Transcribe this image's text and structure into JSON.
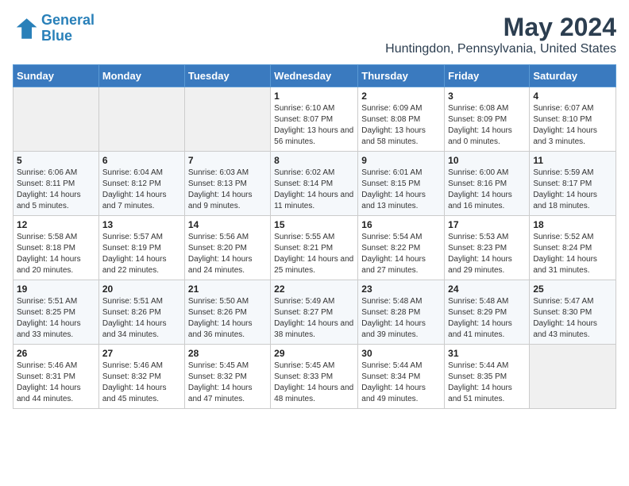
{
  "logo": {
    "line1": "General",
    "line2": "Blue"
  },
  "title": "May 2024",
  "subtitle": "Huntingdon, Pennsylvania, United States",
  "days_of_week": [
    "Sunday",
    "Monday",
    "Tuesday",
    "Wednesday",
    "Thursday",
    "Friday",
    "Saturday"
  ],
  "weeks": [
    [
      {
        "num": "",
        "sunrise": "",
        "sunset": "",
        "daylight": ""
      },
      {
        "num": "",
        "sunrise": "",
        "sunset": "",
        "daylight": ""
      },
      {
        "num": "",
        "sunrise": "",
        "sunset": "",
        "daylight": ""
      },
      {
        "num": "1",
        "sunrise": "Sunrise: 6:10 AM",
        "sunset": "Sunset: 8:07 PM",
        "daylight": "Daylight: 13 hours and 56 minutes."
      },
      {
        "num": "2",
        "sunrise": "Sunrise: 6:09 AM",
        "sunset": "Sunset: 8:08 PM",
        "daylight": "Daylight: 13 hours and 58 minutes."
      },
      {
        "num": "3",
        "sunrise": "Sunrise: 6:08 AM",
        "sunset": "Sunset: 8:09 PM",
        "daylight": "Daylight: 14 hours and 0 minutes."
      },
      {
        "num": "4",
        "sunrise": "Sunrise: 6:07 AM",
        "sunset": "Sunset: 8:10 PM",
        "daylight": "Daylight: 14 hours and 3 minutes."
      }
    ],
    [
      {
        "num": "5",
        "sunrise": "Sunrise: 6:06 AM",
        "sunset": "Sunset: 8:11 PM",
        "daylight": "Daylight: 14 hours and 5 minutes."
      },
      {
        "num": "6",
        "sunrise": "Sunrise: 6:04 AM",
        "sunset": "Sunset: 8:12 PM",
        "daylight": "Daylight: 14 hours and 7 minutes."
      },
      {
        "num": "7",
        "sunrise": "Sunrise: 6:03 AM",
        "sunset": "Sunset: 8:13 PM",
        "daylight": "Daylight: 14 hours and 9 minutes."
      },
      {
        "num": "8",
        "sunrise": "Sunrise: 6:02 AM",
        "sunset": "Sunset: 8:14 PM",
        "daylight": "Daylight: 14 hours and 11 minutes."
      },
      {
        "num": "9",
        "sunrise": "Sunrise: 6:01 AM",
        "sunset": "Sunset: 8:15 PM",
        "daylight": "Daylight: 14 hours and 13 minutes."
      },
      {
        "num": "10",
        "sunrise": "Sunrise: 6:00 AM",
        "sunset": "Sunset: 8:16 PM",
        "daylight": "Daylight: 14 hours and 16 minutes."
      },
      {
        "num": "11",
        "sunrise": "Sunrise: 5:59 AM",
        "sunset": "Sunset: 8:17 PM",
        "daylight": "Daylight: 14 hours and 18 minutes."
      }
    ],
    [
      {
        "num": "12",
        "sunrise": "Sunrise: 5:58 AM",
        "sunset": "Sunset: 8:18 PM",
        "daylight": "Daylight: 14 hours and 20 minutes."
      },
      {
        "num": "13",
        "sunrise": "Sunrise: 5:57 AM",
        "sunset": "Sunset: 8:19 PM",
        "daylight": "Daylight: 14 hours and 22 minutes."
      },
      {
        "num": "14",
        "sunrise": "Sunrise: 5:56 AM",
        "sunset": "Sunset: 8:20 PM",
        "daylight": "Daylight: 14 hours and 24 minutes."
      },
      {
        "num": "15",
        "sunrise": "Sunrise: 5:55 AM",
        "sunset": "Sunset: 8:21 PM",
        "daylight": "Daylight: 14 hours and 25 minutes."
      },
      {
        "num": "16",
        "sunrise": "Sunrise: 5:54 AM",
        "sunset": "Sunset: 8:22 PM",
        "daylight": "Daylight: 14 hours and 27 minutes."
      },
      {
        "num": "17",
        "sunrise": "Sunrise: 5:53 AM",
        "sunset": "Sunset: 8:23 PM",
        "daylight": "Daylight: 14 hours and 29 minutes."
      },
      {
        "num": "18",
        "sunrise": "Sunrise: 5:52 AM",
        "sunset": "Sunset: 8:24 PM",
        "daylight": "Daylight: 14 hours and 31 minutes."
      }
    ],
    [
      {
        "num": "19",
        "sunrise": "Sunrise: 5:51 AM",
        "sunset": "Sunset: 8:25 PM",
        "daylight": "Daylight: 14 hours and 33 minutes."
      },
      {
        "num": "20",
        "sunrise": "Sunrise: 5:51 AM",
        "sunset": "Sunset: 8:26 PM",
        "daylight": "Daylight: 14 hours and 34 minutes."
      },
      {
        "num": "21",
        "sunrise": "Sunrise: 5:50 AM",
        "sunset": "Sunset: 8:26 PM",
        "daylight": "Daylight: 14 hours and 36 minutes."
      },
      {
        "num": "22",
        "sunrise": "Sunrise: 5:49 AM",
        "sunset": "Sunset: 8:27 PM",
        "daylight": "Daylight: 14 hours and 38 minutes."
      },
      {
        "num": "23",
        "sunrise": "Sunrise: 5:48 AM",
        "sunset": "Sunset: 8:28 PM",
        "daylight": "Daylight: 14 hours and 39 minutes."
      },
      {
        "num": "24",
        "sunrise": "Sunrise: 5:48 AM",
        "sunset": "Sunset: 8:29 PM",
        "daylight": "Daylight: 14 hours and 41 minutes."
      },
      {
        "num": "25",
        "sunrise": "Sunrise: 5:47 AM",
        "sunset": "Sunset: 8:30 PM",
        "daylight": "Daylight: 14 hours and 43 minutes."
      }
    ],
    [
      {
        "num": "26",
        "sunrise": "Sunrise: 5:46 AM",
        "sunset": "Sunset: 8:31 PM",
        "daylight": "Daylight: 14 hours and 44 minutes."
      },
      {
        "num": "27",
        "sunrise": "Sunrise: 5:46 AM",
        "sunset": "Sunset: 8:32 PM",
        "daylight": "Daylight: 14 hours and 45 minutes."
      },
      {
        "num": "28",
        "sunrise": "Sunrise: 5:45 AM",
        "sunset": "Sunset: 8:32 PM",
        "daylight": "Daylight: 14 hours and 47 minutes."
      },
      {
        "num": "29",
        "sunrise": "Sunrise: 5:45 AM",
        "sunset": "Sunset: 8:33 PM",
        "daylight": "Daylight: 14 hours and 48 minutes."
      },
      {
        "num": "30",
        "sunrise": "Sunrise: 5:44 AM",
        "sunset": "Sunset: 8:34 PM",
        "daylight": "Daylight: 14 hours and 49 minutes."
      },
      {
        "num": "31",
        "sunrise": "Sunrise: 5:44 AM",
        "sunset": "Sunset: 8:35 PM",
        "daylight": "Daylight: 14 hours and 51 minutes."
      },
      {
        "num": "",
        "sunrise": "",
        "sunset": "",
        "daylight": ""
      }
    ]
  ]
}
